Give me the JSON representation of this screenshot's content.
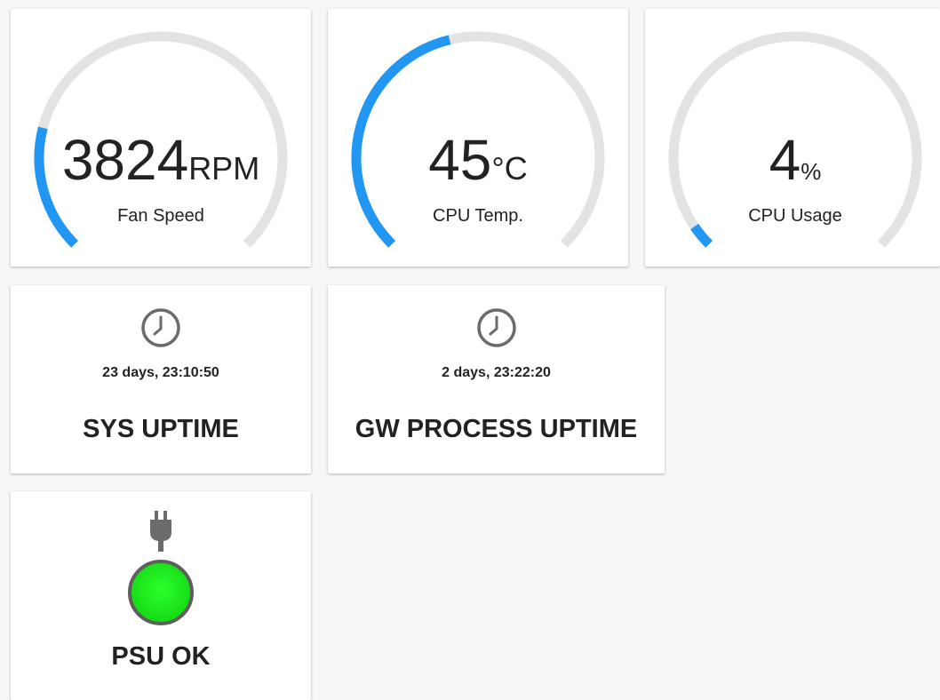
{
  "colors": {
    "gauge_fill": "#2196f3",
    "gauge_track": "#e3e3e3",
    "icon_gray": "#6b6b6b",
    "psu_ok_green": "#1ee61e"
  },
  "gauges": [
    {
      "value": "3824",
      "unit": "RPM",
      "label": "Fan Speed",
      "fill_fraction": 0.22
    },
    {
      "value": "45",
      "unit": "°C",
      "label": "CPU Temp.",
      "fill_fraction": 0.45
    },
    {
      "value": "4",
      "unit": "%",
      "label": "CPU Usage",
      "fill_fraction": 0.04
    }
  ],
  "uptimes": [
    {
      "icon": "clock-icon",
      "value": "23 days, 23:10:50",
      "title": "SYS UPTIME"
    },
    {
      "icon": "clock-icon",
      "value": "2 days, 23:22:20",
      "title": "GW PROCESS UPTIME"
    }
  ],
  "psu": {
    "icon": "power-plug-icon",
    "status_icon": "status-light-icon",
    "title": "PSU OK"
  }
}
